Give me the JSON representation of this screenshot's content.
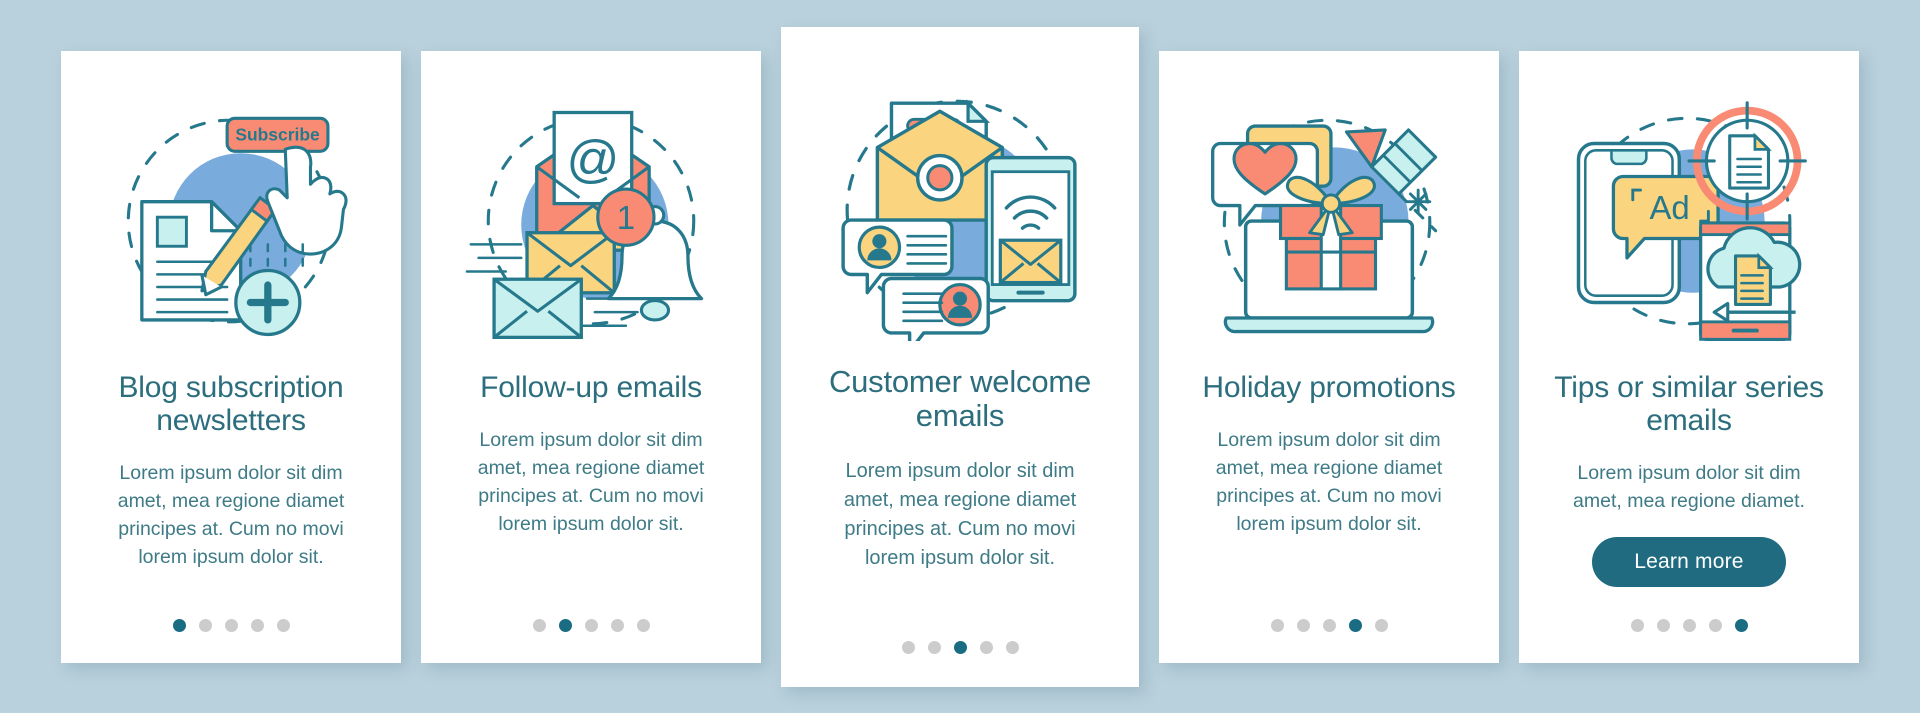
{
  "theme": {
    "background": "#b9d1dc",
    "card_background": "#ffffff",
    "title_color": "#2c6e7d",
    "body_color": "#3e7b86",
    "accent_teal": "#206b80",
    "dot_active": "#1a6c83",
    "dot_inactive": "#cccccc",
    "illus_blue": "#7aabdd",
    "illus_yellow": "#fad47f",
    "illus_coral": "#f98b74",
    "illus_mint": "#c8f0ef",
    "illus_outline": "#26798c"
  },
  "screens": [
    {
      "id": "blog-subscription-newsletters",
      "size": "small",
      "illustration": "subscribe-document",
      "illustration_labels": {
        "button": "Subscribe"
      },
      "title": "Blog subscription newsletters",
      "body": "Lorem ipsum dolor sit dim amet, mea regione diamet principes at. Cum no movi lorem ipsum dolor sit.",
      "cta": null,
      "dots": {
        "count": 5,
        "active_index": 0
      }
    },
    {
      "id": "follow-up-emails",
      "size": "small",
      "illustration": "envelopes-bell",
      "illustration_labels": {
        "at_symbol": "@",
        "badge_count": "1"
      },
      "title": "Follow-up emails",
      "body": "Lorem ipsum dolor sit dim amet, mea regione diamet principes at. Cum no movi lorem ipsum dolor sit.",
      "cta": null,
      "dots": {
        "count": 5,
        "active_index": 1
      }
    },
    {
      "id": "customer-welcome-emails",
      "size": "large",
      "illustration": "welcome-letter-phone",
      "illustration_labels": {},
      "title": "Customer welcome emails",
      "body": "Lorem ipsum dolor sit dim amet, mea regione diamet principes at. Cum no movi lorem ipsum dolor sit.",
      "cta": null,
      "dots": {
        "count": 5,
        "active_index": 2
      }
    },
    {
      "id": "holiday-promotions",
      "size": "small",
      "illustration": "gift-laptop-firework",
      "illustration_labels": {},
      "title": "Holiday promotions",
      "body": "Lorem ipsum dolor sit dim amet, mea regione diamet principes at. Cum no movi lorem ipsum dolor sit.",
      "cta": null,
      "dots": {
        "count": 5,
        "active_index": 3
      }
    },
    {
      "id": "tips-or-similar-series-emails",
      "size": "small",
      "illustration": "ad-phone-target-cloud",
      "illustration_labels": {
        "ad": "Ad"
      },
      "title": "Tips or similar series emails",
      "body": "Lorem ipsum dolor sit dim amet, mea regione diamet.",
      "cta": "Learn more",
      "dots": {
        "count": 5,
        "active_index": 4
      }
    }
  ]
}
